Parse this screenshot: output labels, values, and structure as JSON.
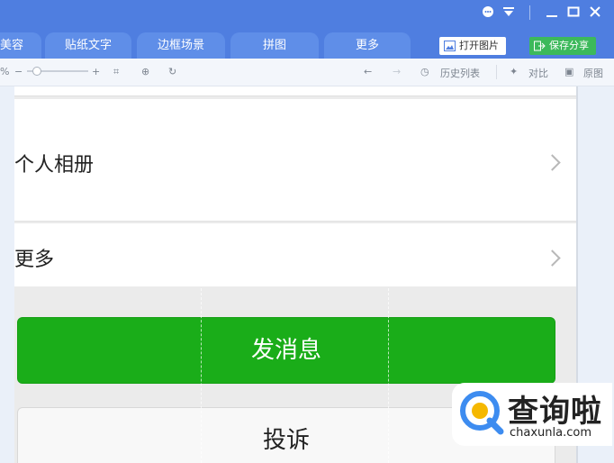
{
  "tabs": [
    "美容",
    "贴纸文字",
    "边框场景",
    "拼图",
    "更多"
  ],
  "buttons": {
    "open": "打开图片",
    "save": "保存分享"
  },
  "toolbar": {
    "history": "历史列表",
    "compare": "对比",
    "original": "原图",
    "percent": "%"
  },
  "list": {
    "album": "个人相册",
    "more": "更多"
  },
  "actions": {
    "send": "发消息",
    "report": "投诉"
  },
  "watermark": {
    "cn": "查询啦",
    "url": "chaxunla.com"
  },
  "colors": {
    "titlebar": "#4f7ee0",
    "tab": "#5f8ee8",
    "save_btn": "#3cb95b",
    "send_btn": "#1aad19"
  }
}
